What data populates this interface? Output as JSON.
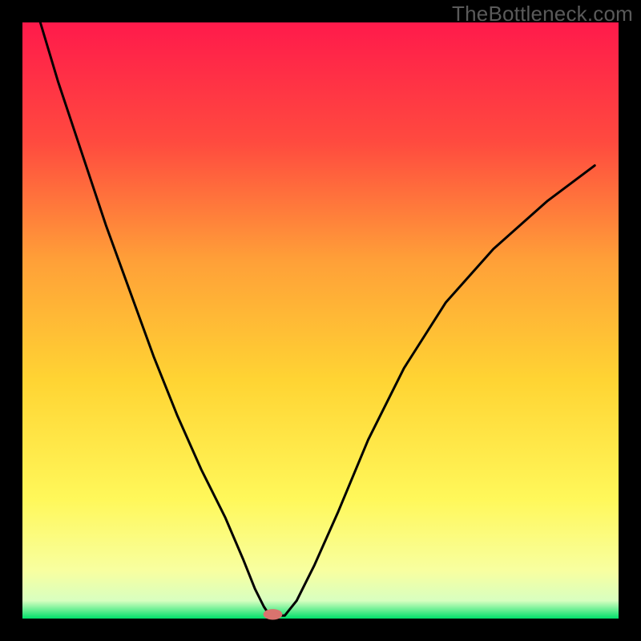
{
  "watermark": "TheBottleneck.com",
  "chart_data": {
    "type": "line",
    "title": "",
    "xlabel": "",
    "ylabel": "",
    "xlim": [
      0,
      100
    ],
    "ylim": [
      0,
      100
    ],
    "grid": false,
    "legend": false,
    "axes_visible": false,
    "background_gradient": {
      "stops": [
        {
          "offset": 0.0,
          "color": "#ff1a4b"
        },
        {
          "offset": 0.2,
          "color": "#ff4a3f"
        },
        {
          "offset": 0.4,
          "color": "#ffa038"
        },
        {
          "offset": 0.6,
          "color": "#ffd433"
        },
        {
          "offset": 0.8,
          "color": "#fff85a"
        },
        {
          "offset": 0.92,
          "color": "#f8ffa0"
        },
        {
          "offset": 0.97,
          "color": "#d8ffc0"
        },
        {
          "offset": 1.0,
          "color": "#00e06a"
        }
      ]
    },
    "border_color": "#000000",
    "border_width_px": 28,
    "series": [
      {
        "name": "bottleneck-curve",
        "color": "#000000",
        "stroke_width_px": 3,
        "x": [
          3.0,
          6.0,
          10.0,
          14.0,
          18.0,
          22.0,
          26.0,
          30.0,
          34.0,
          37.0,
          39.0,
          40.5,
          41.5,
          42.5,
          44.0,
          46.0,
          49.0,
          53.0,
          58.0,
          64.0,
          71.0,
          79.0,
          88.0,
          96.0
        ],
        "y": [
          100.0,
          90.0,
          78.0,
          66.0,
          55.0,
          44.0,
          34.0,
          25.0,
          17.0,
          10.0,
          5.0,
          2.0,
          0.5,
          0.5,
          0.5,
          3.0,
          9.0,
          18.0,
          30.0,
          42.0,
          53.0,
          62.0,
          70.0,
          76.0
        ]
      }
    ],
    "marker": {
      "name": "optimal-point",
      "cx": 42.0,
      "cy": 0.7,
      "rx": 1.6,
      "ry": 0.9,
      "fill": "#d9736e"
    }
  }
}
